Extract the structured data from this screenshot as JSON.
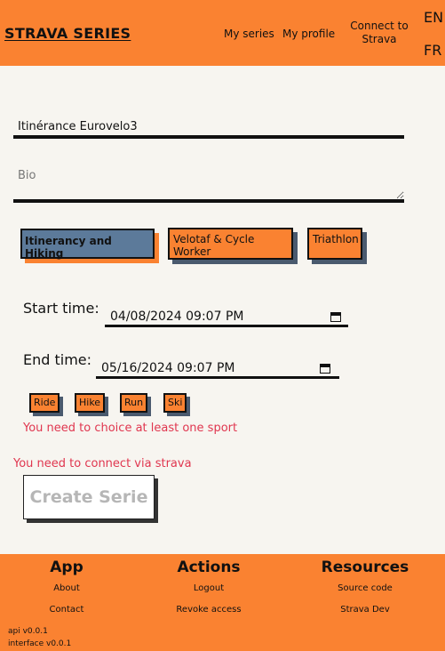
{
  "header": {
    "brand": "STRAVA SERIES",
    "nav": {
      "my_series": "My series",
      "my_profile": "My profile",
      "connect": "Connect to Strava"
    },
    "languages": [
      "EN",
      "FR"
    ]
  },
  "form": {
    "name_value": "Itinérance Eurovelo3",
    "bio_placeholder": "Bio",
    "categories": [
      {
        "label": "Itinerancy and Hiking",
        "selected": true
      },
      {
        "label": "Velotaf & Cycle Worker",
        "selected": false
      },
      {
        "label": "Triathlon",
        "selected": false
      }
    ],
    "start_label": "Start time:",
    "start_value": "04/08/2024 09:07 PM",
    "end_label": "End time:",
    "end_value": "05/16/2024 09:07 PM",
    "sports": [
      "Ride",
      "Hike",
      "Run",
      "Ski"
    ],
    "error_sport": "You need to choice at least one sport",
    "error_strava": "You need to connect via strava",
    "submit_label": "Create Serie"
  },
  "footer": {
    "columns": [
      {
        "title": "App",
        "links": [
          "About",
          "Contact"
        ]
      },
      {
        "title": "Actions",
        "links": [
          "Logout",
          "Revoke access"
        ]
      },
      {
        "title": "Resources",
        "links": [
          "Source code",
          "Strava Dev"
        ]
      }
    ],
    "versions": [
      "api v0.0.1",
      "interface v0.0.1"
    ]
  },
  "colors": {
    "accent": "#fa8231",
    "background": "#f7f5f0",
    "selected_chip": "#5c7a9a",
    "error": "#e0364f"
  }
}
